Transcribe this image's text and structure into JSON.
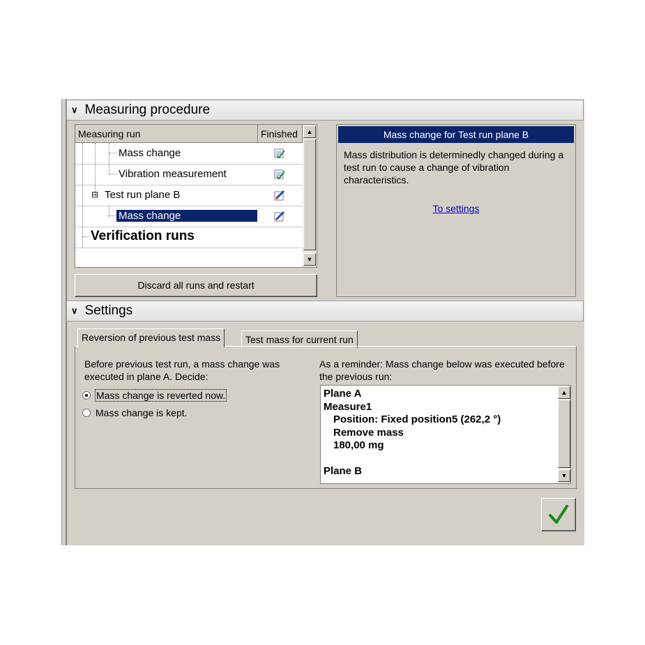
{
  "procedure": {
    "header": "Measuring procedure",
    "tree": {
      "columns": [
        "Measuring run",
        "Finished"
      ],
      "rows": [
        {
          "label": "Mass change",
          "finished_icon": "checklist-done-icon"
        },
        {
          "label": "Vibration measurement",
          "finished_icon": "checklist-done-icon"
        },
        {
          "label": "Test run plane B",
          "finished_icon": "pencil-edit-icon"
        },
        {
          "label": "Mass change",
          "finished_icon": "pencil-edit-icon",
          "selected": true
        },
        {
          "label": "Verification runs"
        }
      ],
      "expander": "⊟"
    },
    "discard_button": "Discard all runs and restart",
    "info": {
      "title": "Mass change for Test run plane B",
      "description": "Mass distribution is determinedly changed during a test run to cause a change of vibration characteristics.",
      "link": "To settings"
    }
  },
  "settings": {
    "header": "Settings",
    "tabs": [
      "Reversion of previous test mass",
      "Test mass for current run"
    ],
    "active_tab": 0,
    "prompt": "Before previous test run, a mass change was executed in plane A. Decide:",
    "options": [
      {
        "label": "Mass change is reverted now.",
        "checked": true
      },
      {
        "label": "Mass change is kept.",
        "checked": false
      }
    ],
    "reminder": "As a reminder: Mass change below was executed before the previous run:",
    "memo_lines": [
      "Plane A",
      "Measure1",
      "  Position: Fixed position5 (262,2 °)",
      "  Remove mass",
      "  180,00 mg",
      "",
      "Plane B"
    ]
  },
  "ok_button_icon": "checkmark-icon",
  "colors": {
    "selection": "#0a246a",
    "link": "#0000cc",
    "ok_check": "#1a8a1a"
  }
}
